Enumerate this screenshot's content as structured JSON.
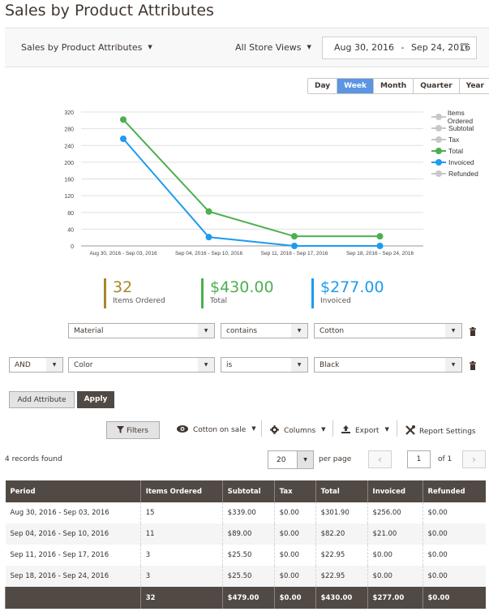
{
  "page": {
    "title": "Sales by Product Attributes"
  },
  "toolbar": {
    "report_select": "Sales by Product Attributes",
    "store_select": "All Store Views",
    "date_from": "Aug 30, 2016",
    "date_sep": "-",
    "date_to": "Sep 24, 2016"
  },
  "period_tabs": [
    {
      "label": "Day",
      "active": false
    },
    {
      "label": "Week",
      "active": true
    },
    {
      "label": "Month",
      "active": false
    },
    {
      "label": "Quarter",
      "active": false
    },
    {
      "label": "Year",
      "active": false
    }
  ],
  "chart_data": {
    "type": "line",
    "title": "",
    "xlabel": "",
    "ylabel": "",
    "ylim": [
      0,
      320
    ],
    "yticks": [
      0,
      40,
      80,
      120,
      160,
      200,
      240,
      280,
      320
    ],
    "grid": true,
    "legend_position": "right",
    "categories": [
      "Aug 30, 2016 - Sep 03, 2016",
      "Sep 04, 2016 - Sep 10, 2016",
      "Sep 11, 2016 - Sep 17, 2016",
      "Sep 18, 2016 - Sep 24, 2016"
    ],
    "series": [
      {
        "name": "Items Ordered",
        "visible": false,
        "color": "#c8c8c8",
        "values": [
          15,
          11,
          3,
          3
        ]
      },
      {
        "name": "Subtotal",
        "visible": false,
        "color": "#c8c8c8",
        "values": [
          339.0,
          89.0,
          25.5,
          25.5
        ]
      },
      {
        "name": "Tax",
        "visible": false,
        "color": "#c8c8c8",
        "values": [
          0,
          0,
          0,
          0
        ]
      },
      {
        "name": "Total",
        "visible": true,
        "color": "#4caf50",
        "values": [
          301.9,
          82.2,
          22.95,
          22.95
        ]
      },
      {
        "name": "Invoiced",
        "visible": true,
        "color": "#1e9bf0",
        "values": [
          256.0,
          21.0,
          0,
          0
        ]
      },
      {
        "name": "Refunded",
        "visible": false,
        "color": "#c8c8c8",
        "values": [
          0,
          0,
          0,
          0
        ]
      }
    ]
  },
  "kpis": [
    {
      "value": "32",
      "label": "Items Ordered",
      "color": "#a6872b"
    },
    {
      "value": "$430.00",
      "label": "Total",
      "color": "#4caf50"
    },
    {
      "value": "$277.00",
      "label": "Invoiced",
      "color": "#1e9bf0"
    }
  ],
  "conditions": [
    {
      "logic": "",
      "attribute": "Material",
      "operator": "contains",
      "value": "Cotton"
    },
    {
      "logic": "AND",
      "attribute": "Color",
      "operator": "is",
      "value": "Black"
    }
  ],
  "buttons": {
    "add_attribute": "Add Attribute",
    "apply": "Apply"
  },
  "grid_actions": {
    "filters": "Filters",
    "view": "Cotton on sale",
    "columns": "Columns",
    "export": "Export",
    "report_settings": "Report Settings"
  },
  "pager": {
    "records_found": "4 records found",
    "per_page_value": "20",
    "per_page_label": "per page",
    "current_page": "1",
    "of_pages": "of 1"
  },
  "table": {
    "columns": [
      "Period",
      "Items Ordered",
      "Subtotal",
      "Tax",
      "Total",
      "Invoiced",
      "Refunded"
    ],
    "rows": [
      [
        "Aug 30, 2016 - Sep 03, 2016",
        "15",
        "$339.00",
        "$0.00",
        "$301.90",
        "$256.00",
        "$0.00"
      ],
      [
        "Sep 04, 2016 - Sep 10, 2016",
        "11",
        "$89.00",
        "$0.00",
        "$82.20",
        "$21.00",
        "$0.00"
      ],
      [
        "Sep 11, 2016 - Sep 17, 2016",
        "3",
        "$25.50",
        "$0.00",
        "$22.95",
        "$0.00",
        "$0.00"
      ],
      [
        "Sep 18, 2016 - Sep 24, 2016",
        "3",
        "$25.50",
        "$0.00",
        "$22.95",
        "$0.00",
        "$0.00"
      ]
    ],
    "totals": [
      "",
      "32",
      "$479.00",
      "$0.00",
      "$430.00",
      "$277.00",
      "$0.00"
    ]
  }
}
